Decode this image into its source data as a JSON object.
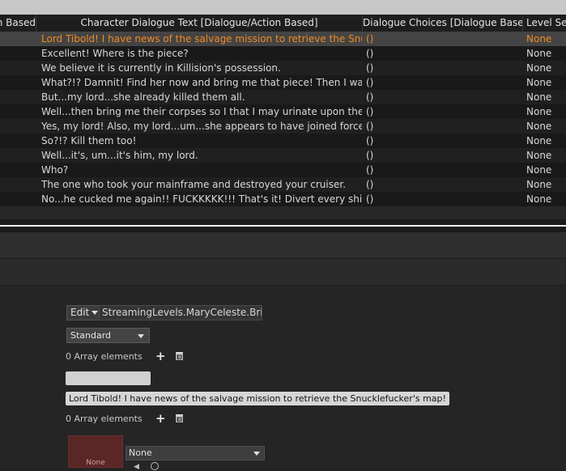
{
  "table": {
    "columns": [
      "n Based]",
      "Character Dialogue Text [Dialogue/Action Based]",
      "Dialogue Choices [Dialogue Based]",
      "Level Sec"
    ],
    "rows": [
      {
        "text": "Lord Tibold! I have news of the salvage mission to retrieve the Snucklefuc",
        "choices": "()",
        "level": "None",
        "selected": true
      },
      {
        "text": "Excellent! Where is the piece?",
        "choices": "()",
        "level": "None"
      },
      {
        "text": "We believe it is currently in Killision's possession.",
        "choices": "()",
        "level": "None"
      },
      {
        "text": "What?!? Damnit! Find her now and bring me that piece! Then I want you to",
        "choices": "()",
        "level": "None"
      },
      {
        "text": "But...my lord...she already killed them all.",
        "choices": "()",
        "level": "None"
      },
      {
        "text": "Well...then bring me their corpses so I that I may urinate upon them!",
        "choices": "()",
        "level": "None"
      },
      {
        "text": "Yes, my lord! Also, my lord...um...she appears to have joined forces with a",
        "choices": "()",
        "level": "None"
      },
      {
        "text": "So?!? Kill them too!",
        "choices": "()",
        "level": "None"
      },
      {
        "text": "Well...it's, um...it's him, my lord.",
        "choices": "()",
        "level": "None"
      },
      {
        "text": "Who?",
        "choices": "()",
        "level": "None"
      },
      {
        "text": "The one who took your mainframe and destroyed your cruiser.",
        "choices": "()",
        "level": "None"
      },
      {
        "text": "No...he cucked me again!! FUCKKKKK!!! That's it! Divert every ship! We're",
        "choices": "()",
        "level": "None"
      }
    ]
  },
  "details": {
    "edit_label": "Edit",
    "level_path": "StreamingLevels.MaryCeleste.Bridge",
    "mode_value": "Standard",
    "array1_label": "0 Array elements",
    "dialogue_text": "Lord Tibold! I have news of the salvage mission to retrieve the Snucklefucker's map!",
    "array2_label": "0 Array elements",
    "thumbnail_label": "None",
    "asset_value": "None"
  },
  "colors": {
    "selected_text": "#f08a22",
    "background": "#242424"
  },
  "icons": [
    "plus-icon",
    "trash-icon",
    "chevron-down-icon",
    "arrow-icon",
    "browse-icon"
  ]
}
